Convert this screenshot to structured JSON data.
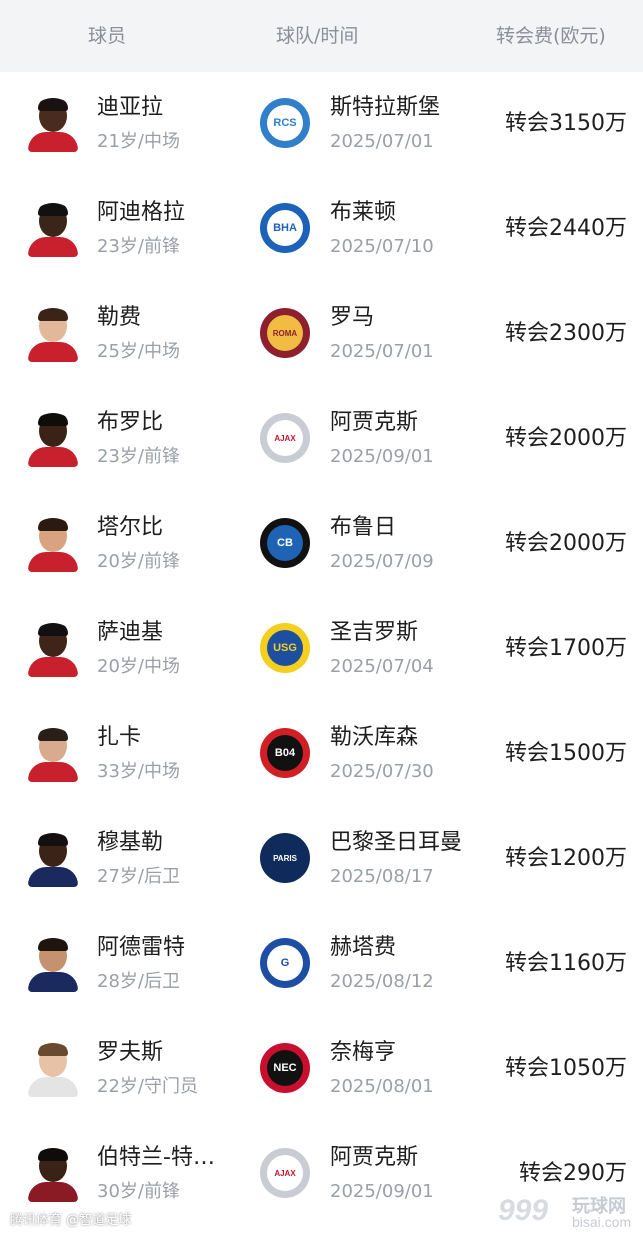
{
  "header": {
    "col_player": "球员",
    "col_team": "球队/时间",
    "col_fee": "转会费(欧元)"
  },
  "rows": [
    {
      "name": "迪亚拉",
      "meta": "21岁/中场",
      "team": "斯特拉斯堡",
      "date": "2025/07/01",
      "fee": "转会3150万",
      "badge_icon": "strasbourg-crest-icon",
      "badge_ring": "#2f7fc9",
      "badge_fill": "#ffffff",
      "badge_text": "RCS",
      "badge_text_color": "#2f7fc9",
      "skin": "#4a2c1e",
      "hair": "#1a1210",
      "shirt": "#c8202c"
    },
    {
      "name": "阿迪格拉",
      "meta": "23岁/前锋",
      "team": "布莱顿",
      "date": "2025/07/10",
      "fee": "转会2440万",
      "badge_icon": "brighton-crest-icon",
      "badge_ring": "#1c62b9",
      "badge_fill": "#ffffff",
      "badge_text": "BHA",
      "badge_text_color": "#1c62b9",
      "skin": "#3b2418",
      "hair": "#111111",
      "shirt": "#c8202c"
    },
    {
      "name": "勒费",
      "meta": "25岁/中场",
      "team": "罗马",
      "date": "2025/07/01",
      "fee": "转会2300万",
      "badge_icon": "roma-crest-icon",
      "badge_ring": "#8e1f2f",
      "badge_fill": "#f0bc42",
      "badge_text": "ROMA",
      "badge_text_color": "#8e1f2f",
      "skin": "#e2b79a",
      "hair": "#3a2418",
      "shirt": "#c8202c"
    },
    {
      "name": "布罗比",
      "meta": "23岁/前锋",
      "team": "阿贾克斯",
      "date": "2025/09/01",
      "fee": "转会2000万",
      "badge_icon": "ajax-crest-icon",
      "badge_ring": "#c9ccd2",
      "badge_fill": "#ffffff",
      "badge_text": "AJAX",
      "badge_text_color": "#c8102e",
      "skin": "#3a2216",
      "hair": "#0f0c0a",
      "shirt": "#c8202c"
    },
    {
      "name": "塔尔比",
      "meta": "20岁/前锋",
      "team": "布鲁日",
      "date": "2025/07/09",
      "fee": "转会2000万",
      "badge_icon": "club-brugge-crest-icon",
      "badge_ring": "#111111",
      "badge_fill": "#1f63b4",
      "badge_text": "CB",
      "badge_text_color": "#ffffff",
      "skin": "#d9a37f",
      "hair": "#2b1a10",
      "shirt": "#c8202c"
    },
    {
      "name": "萨迪基",
      "meta": "20岁/中场",
      "team": "圣吉罗斯",
      "date": "2025/07/04",
      "fee": "转会1700万",
      "badge_icon": "union-sg-crest-icon",
      "badge_ring": "#f4cf1f",
      "badge_fill": "#1c4fa0",
      "badge_text": "USG",
      "badge_text_color": "#f4cf1f",
      "skin": "#3f2519",
      "hair": "#121010",
      "shirt": "#c8202c"
    },
    {
      "name": "扎卡",
      "meta": "33岁/中场",
      "team": "勒沃库森",
      "date": "2025/07/30",
      "fee": "转会1500万",
      "badge_icon": "leverkusen-crest-icon",
      "badge_ring": "#d11f26",
      "badge_fill": "#111111",
      "badge_text": "B04",
      "badge_text_color": "#ffffff",
      "skin": "#d8ab8e",
      "hair": "#2a1e18",
      "shirt": "#c8202c"
    },
    {
      "name": "穆基勒",
      "meta": "27岁/后卫",
      "team": "巴黎圣日耳曼",
      "date": "2025/08/17",
      "fee": "转会1200万",
      "badge_icon": "psg-crest-icon",
      "badge_ring": "#0f2b5b",
      "badge_fill": "#0f2b5b",
      "badge_text": "PARIS",
      "badge_text_color": "#ffffff",
      "skin": "#3b2318",
      "hair": "#141010",
      "shirt": "#1a2a5e"
    },
    {
      "name": "阿德雷特",
      "meta": "28岁/后卫",
      "team": "赫塔费",
      "date": "2025/08/12",
      "fee": "转会1160万",
      "badge_icon": "getafe-crest-icon",
      "badge_ring": "#1d4ea3",
      "badge_fill": "#ffffff",
      "badge_text": "G",
      "badge_text_color": "#1d4ea3",
      "skin": "#c4926e",
      "hair": "#1e1410",
      "shirt": "#1a2a5e"
    },
    {
      "name": "罗夫斯",
      "meta": "22岁/守门员",
      "team": "奈梅亨",
      "date": "2025/08/01",
      "fee": "转会1050万",
      "badge_icon": "nec-crest-icon",
      "badge_ring": "#c8102e",
      "badge_fill": "#111111",
      "badge_text": "NEC",
      "badge_text_color": "#ffffff",
      "skin": "#e8c2a6",
      "hair": "#6a4a2e",
      "shirt": "#e4e4e4"
    },
    {
      "name": "伯特兰-特…",
      "meta": "30岁/前锋",
      "team": "阿贾克斯",
      "date": "2025/09/01",
      "fee": "转会290万",
      "badge_icon": "ajax-crest-icon",
      "badge_ring": "#c9ccd2",
      "badge_fill": "#ffffff",
      "badge_text": "AJAX",
      "badge_text_color": "#c8102e",
      "skin": "#3a2216",
      "hair": "#0f0c0a",
      "shirt": "#8a1a24"
    }
  ],
  "watermark": {
    "left_text": "腾讯体育 @智道足球",
    "right_number": "999",
    "right_cn": "玩球网",
    "right_domain": "bisai.com"
  }
}
